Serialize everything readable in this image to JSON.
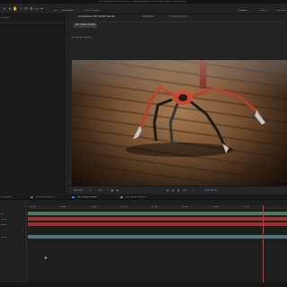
{
  "window": {
    "title": "Adobe After Effects (Beta) - /Users/jessalyckmans/Desktop/AE Tutorial.aep *"
  },
  "toolbar": {
    "snap_label": "Sel",
    "orientation_label": "Orientation",
    "draft_label": "Top 3D Layers",
    "workspaces": [
      "Default",
      "Learn",
      "Standard"
    ]
  },
  "left_panel": {
    "label": "Content"
  },
  "viewer": {
    "tab_composition": "Composition SSC Spider Render",
    "tab_metadata": "Metadata",
    "tab_footage": "Footage (none)",
    "comp_chip": "SSC Spider Render",
    "sub_label": "SSC Spider Render",
    "zoom": "(55.8%)",
    "resolution": "Full",
    "timecode": "0:00:01:04",
    "frame_count": "0.0"
  },
  "timeline": {
    "panel_label": "Properties",
    "tabs": [
      "SSB Animated 3D",
      "SSC Spider Render",
      "SSC Spider Nature"
    ],
    "rows": [
      "Lo",
      "Mrow",
      "Sibre",
      "",
      "Mrow"
    ],
    "ruler_ticks": [
      "00:12f",
      "01:12f",
      "02:12f",
      "03:12f",
      "04:12f",
      "05:12f",
      "06:12f",
      "07:12f"
    ]
  },
  "colors": {
    "accent_blue": "#2d7fe0",
    "layer_green": "#4f7a5f",
    "layer_red": "#9b3232",
    "layer_teal": "#4f7977",
    "playhead": "#c93333"
  }
}
